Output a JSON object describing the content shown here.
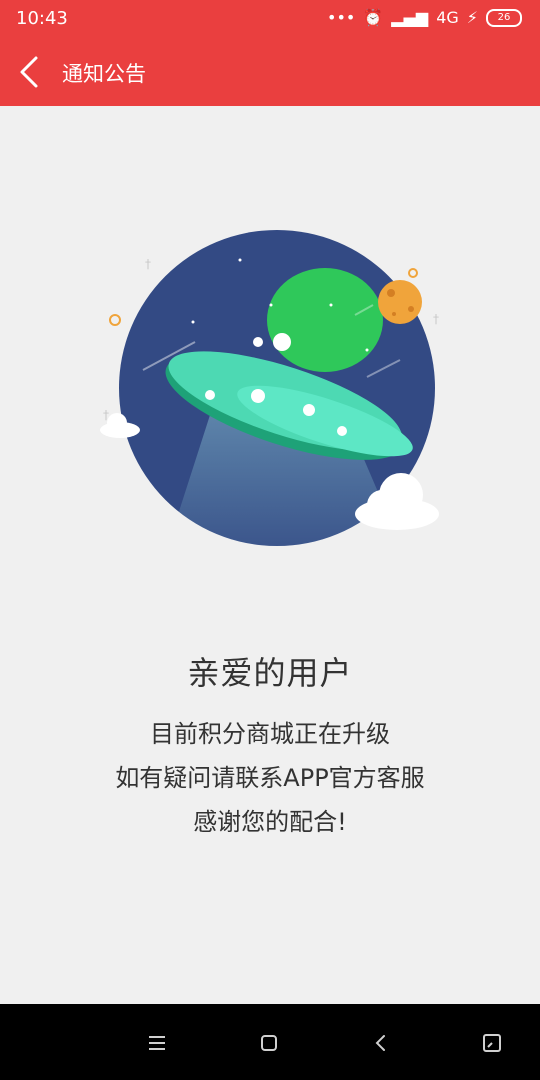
{
  "status_bar": {
    "time": "10:43",
    "network": "4G",
    "battery": "26"
  },
  "header": {
    "title": "通知公告",
    "back_icon": "back-arrow-icon"
  },
  "illustration": {
    "name": "ufo-space-illustration"
  },
  "message": {
    "title": "亲爱的用户",
    "lines": [
      "目前积分商城正在升级",
      "如有疑问请联系APP官方客服",
      "感谢您的配合!"
    ]
  },
  "nav_bar": {
    "icons": [
      "menu-icon",
      "home-icon",
      "back-icon",
      "recent-apps-icon"
    ]
  },
  "colors": {
    "header": "#ea3f3f",
    "background": "#f0f0f0",
    "planet": "#334a84",
    "ufo": "#4dd9b3",
    "moon": "#f0a43b"
  }
}
